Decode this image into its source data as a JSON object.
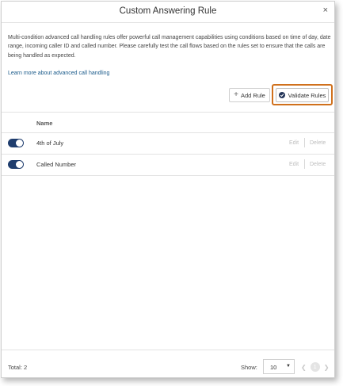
{
  "dialog": {
    "title": "Custom Answering Rule",
    "close_label": "×",
    "description": "Multi-condition advanced call handling rules offer powerful call management capabilities using conditions based on time of day, date range, incoming caller ID and called number. Please carefully test the call flows based on the rules set to ensure that the calls are being handled as expected.",
    "learn_more": "Learn more about advanced call handling"
  },
  "toolbar": {
    "add_rule_label": "Add Rule",
    "add_icon": "plus-icon",
    "validate_label": "Validate Rules",
    "validate_icon": "check-circle-icon",
    "highlight_color": "#d0701c"
  },
  "table": {
    "column_header": "Name",
    "rows": [
      {
        "name": "4th of July",
        "enabled": true,
        "edit_label": "Edit",
        "delete_label": "Delete"
      },
      {
        "name": "Called Number",
        "enabled": true,
        "edit_label": "Edit",
        "delete_label": "Delete"
      }
    ],
    "toggle_color": "#1f3d6e"
  },
  "footer": {
    "total_label": "Total: 2",
    "show_label": "Show:",
    "page_size": "10",
    "current_page": "1",
    "prev_icon": "chevron-left-icon",
    "next_icon": "chevron-right-icon"
  }
}
